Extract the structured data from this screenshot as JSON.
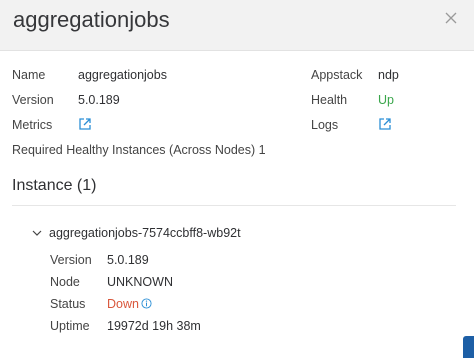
{
  "header": {
    "title": "aggregationjobs"
  },
  "details": {
    "name_label": "Name",
    "name_value": "aggregationjobs",
    "version_label": "Version",
    "version_value": "5.0.189",
    "metrics_label": "Metrics",
    "appstack_label": "Appstack",
    "appstack_value": "ndp",
    "health_label": "Health",
    "health_value": "Up",
    "logs_label": "Logs",
    "required_text": "Required Healthy Instances (Across Nodes) 1"
  },
  "instance_section": {
    "title": "Instance (1)",
    "instance": {
      "name": "aggregationjobs-7574ccbff8-wb92t",
      "version_label": "Version",
      "version_value": "5.0.189",
      "node_label": "Node",
      "node_value": "UNKNOWN",
      "status_label": "Status",
      "status_value": "Down",
      "uptime_label": "Uptime",
      "uptime_value": "19972d 19h 38m"
    }
  },
  "icons": {
    "close": "close-icon",
    "external_link": "external-link-icon",
    "info": "info-icon",
    "chevron": "chevron-down-icon"
  },
  "colors": {
    "up": "#3aa64b",
    "down": "#d9573c",
    "link": "#2b8fd6"
  }
}
